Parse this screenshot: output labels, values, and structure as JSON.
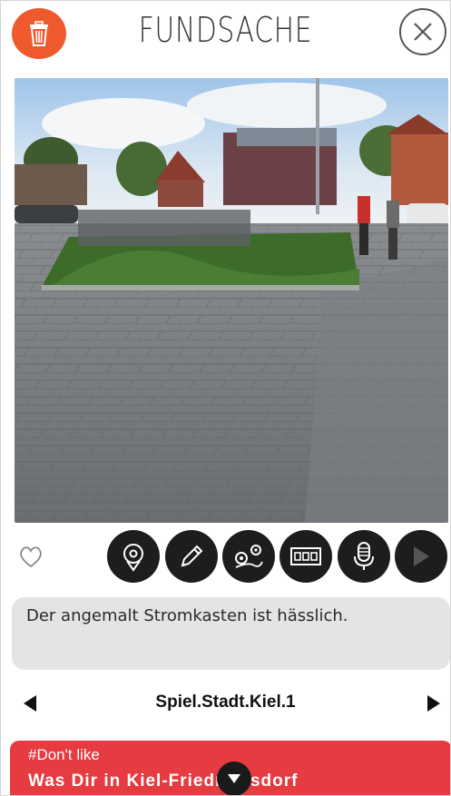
{
  "header": {
    "title": "FUNDSACHE",
    "delete_icon": "trash-icon",
    "close_icon": "close-icon",
    "accent_color": "#ee5a2d"
  },
  "photo": {
    "description_icon": "photo"
  },
  "toolbar": {
    "like_icon": "heart-outline-icon",
    "tools": [
      "location-pin-icon",
      "pencil-icon",
      "route-icon",
      "film-strip-icon",
      "microphone-icon",
      "play-icon"
    ]
  },
  "comment": {
    "text": "Der angemalt Stromkasten ist hässlich."
  },
  "set_selector": {
    "name": "Spiel.Stadt.Kiel.1"
  },
  "banner": {
    "tag": "#Don't like",
    "description": "Was Dir in Kiel-Friedrichsdorf",
    "color": "#e63b41"
  }
}
